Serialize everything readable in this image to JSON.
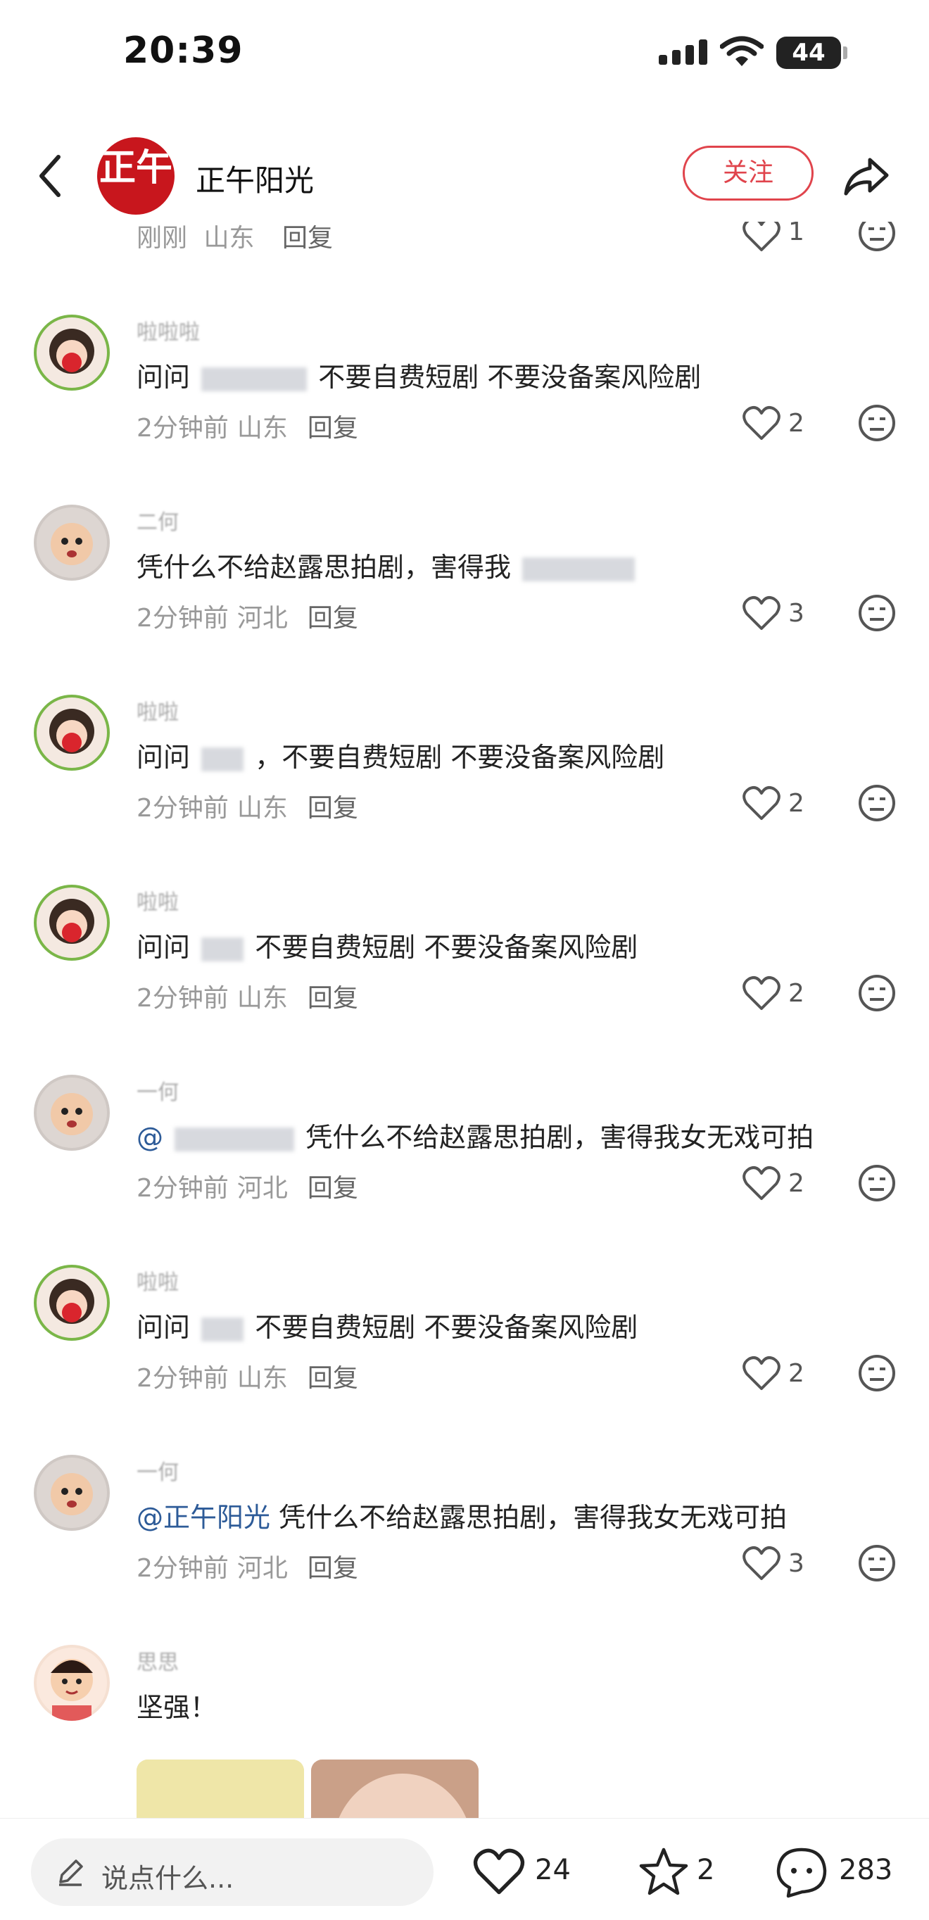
{
  "status_bar": {
    "time": "20:39",
    "battery": "44"
  },
  "header": {
    "author_name": "正午阳光",
    "avatar_text": "正午",
    "follow_label": "关注"
  },
  "top_partial": {
    "time": "刚刚",
    "location": "山东",
    "reply": "回复",
    "likes": "1"
  },
  "comments": [
    {
      "avatar": "green",
      "text_prefix": "问问",
      "text_main": "不要自费短剧 不要没备案风险剧",
      "time": "2分钟前",
      "location": "山东",
      "reply": "回复",
      "likes": "2"
    },
    {
      "avatar": "gray",
      "text_prefix": "",
      "text_main": "凭什么不给赵露思拍剧，害得我",
      "time": "2分钟前",
      "location": "河北",
      "reply": "回复",
      "likes": "3"
    },
    {
      "avatar": "green",
      "text_prefix": "问问",
      "text_main": "，不要自费短剧 不要没备案风险剧",
      "time": "2分钟前",
      "location": "山东",
      "reply": "回复",
      "likes": "2"
    },
    {
      "avatar": "green",
      "text_prefix": "问问",
      "text_main": "不要自费短剧 不要没备案风险剧",
      "time": "2分钟前",
      "location": "山东",
      "reply": "回复",
      "likes": "2"
    },
    {
      "avatar": "gray",
      "text_prefix": "@",
      "text_main": "凭什么不给赵露思拍剧，害得我女无戏可拍",
      "time": "2分钟前",
      "location": "河北",
      "reply": "回复",
      "likes": "2"
    },
    {
      "avatar": "green",
      "text_prefix": "问问",
      "text_main": "不要自费短剧 不要没备案风险剧",
      "time": "2分钟前",
      "location": "山东",
      "reply": "回复",
      "likes": "2"
    },
    {
      "avatar": "gray",
      "text_prefix": "@正午阳光",
      "text_main": "凭什么不给赵露思拍剧，害得我女无戏可拍",
      "time": "2分钟前",
      "location": "河北",
      "reply": "回复",
      "likes": "3"
    },
    {
      "avatar": "face",
      "text_prefix": "",
      "text_main": "坚强！",
      "time": "",
      "location": "",
      "reply": "",
      "likes": ""
    }
  ],
  "bottom_bar": {
    "placeholder": "说点什么...",
    "likes": "24",
    "stars": "2",
    "comments": "283"
  },
  "icons": [
    "back-icon",
    "share-icon",
    "heart-icon",
    "dislike-face-icon",
    "pen-icon",
    "star-icon",
    "chat-icon",
    "signal-icon",
    "wifi-icon"
  ],
  "colors": {
    "accent": "#e0444c",
    "mention": "#2d5b98",
    "meta": "#999999"
  }
}
